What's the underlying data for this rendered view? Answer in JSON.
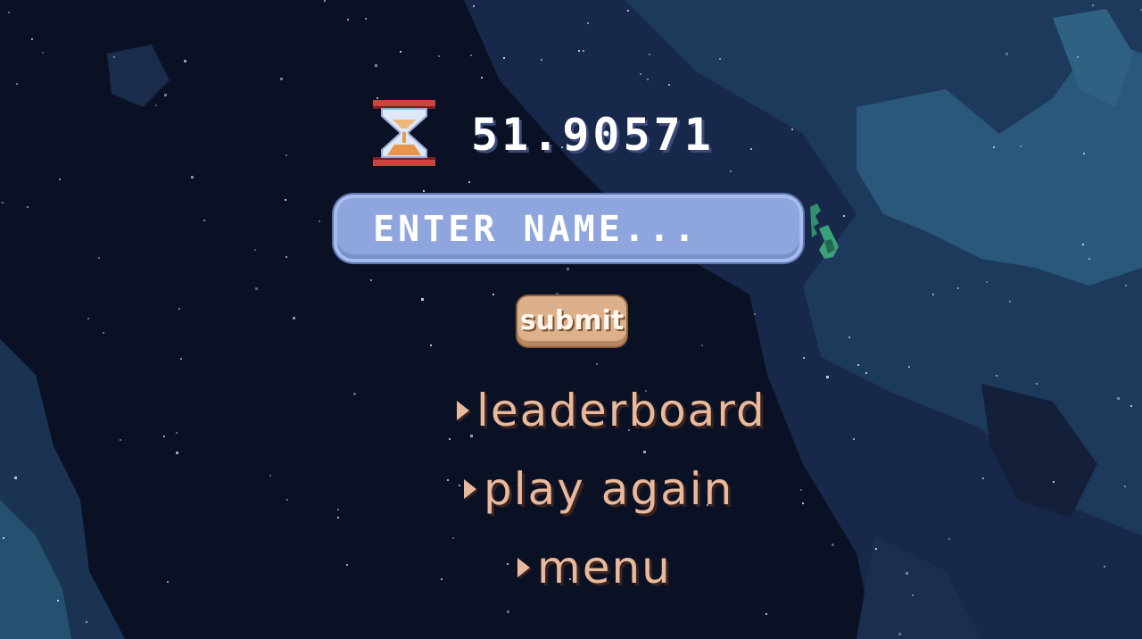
{
  "hud": {
    "timer_icon": "hourglass-icon",
    "time_value": "51.90571"
  },
  "name_entry": {
    "placeholder": "ENTER NAME...",
    "decoration_icon": "sprout-icon"
  },
  "submit": {
    "label": "submit"
  },
  "menu": {
    "items": [
      {
        "label": "leaderboard",
        "icon": "arrow-right-icon"
      },
      {
        "label": "play again",
        "icon": "arrow-right-icon"
      },
      {
        "label": "menu",
        "icon": "arrow-right-icon"
      }
    ]
  },
  "colors": {
    "background": "#0b1124",
    "nebula": "#1d3a5c",
    "input_fill": "#8ea5dd",
    "button_fill": "#dcb08a",
    "menu_text": "#e8b99a",
    "time_text": "#ffffff"
  }
}
